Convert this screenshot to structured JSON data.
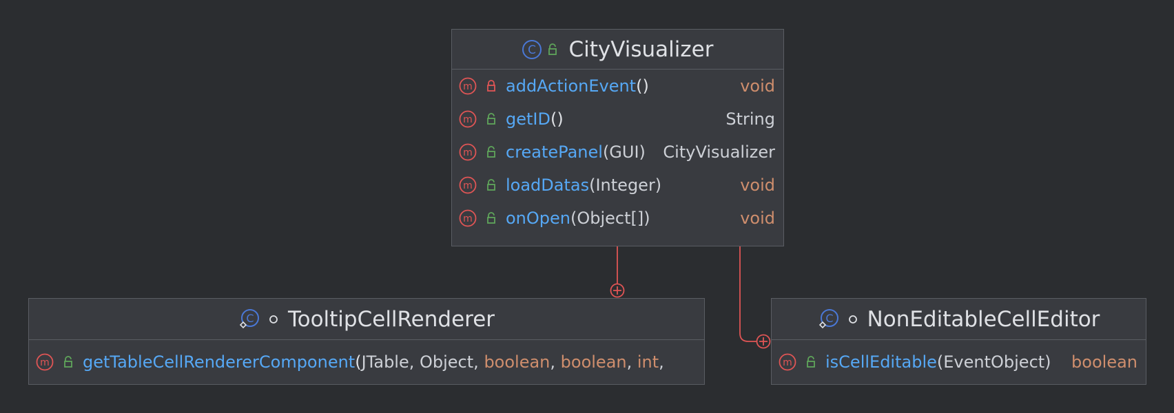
{
  "colors": {
    "background": "#2b2d30",
    "box_fill": "#393b40",
    "box_border": "#5a5d63",
    "method_name": "#56a8f5",
    "keyword_type": "#cf8e6d",
    "class_icon": "#4a78d6",
    "method_icon": "#e05555",
    "public_lock": "#5fa55a",
    "private_lock": "#e05555",
    "connector": "#e05555"
  },
  "classes": {
    "city_visualizer": {
      "name": "CityVisualizer",
      "class_icon": "class-icon",
      "visibility_icon": "public-lock-icon",
      "methods": [
        {
          "name": "addActionEvent",
          "params": "()",
          "return_type": "void",
          "visibility": "private"
        },
        {
          "name": "getID",
          "params": "()",
          "return_type": "String",
          "visibility": "public"
        },
        {
          "name": "createPanel",
          "params": "(GUI)",
          "return_type": "CityVisualizer",
          "visibility": "public"
        },
        {
          "name": "loadDatas",
          "params": "(Integer)",
          "return_type": "void",
          "visibility": "public"
        },
        {
          "name": "onOpen",
          "params": "(Object[])",
          "return_type": "void",
          "visibility": "public"
        }
      ]
    },
    "tooltip_cell_renderer": {
      "name": "TooltipCellRenderer",
      "class_icon": "inner-class-icon",
      "visibility_icon": "package-private-icon",
      "methods": [
        {
          "name": "getTableCellRendererComponent",
          "params_parts": [
            "(",
            "JTable",
            ", ",
            "Object",
            ", ",
            "boolean",
            ", ",
            "boolean",
            ", ",
            "int",
            ","
          ],
          "visibility": "public"
        }
      ]
    },
    "non_editable_cell_editor": {
      "name": "NonEditableCellEditor",
      "class_icon": "inner-class-icon",
      "visibility_icon": "package-private-icon",
      "methods": [
        {
          "name": "isCellEditable",
          "params": "(EventObject)",
          "return_type": "boolean",
          "visibility": "public"
        }
      ]
    }
  },
  "connectors": [
    {
      "from": "CityVisualizer",
      "to": "TooltipCellRenderer",
      "type": "inner-class"
    },
    {
      "from": "CityVisualizer",
      "to": "NonEditableCellEditor",
      "type": "inner-class"
    }
  ]
}
